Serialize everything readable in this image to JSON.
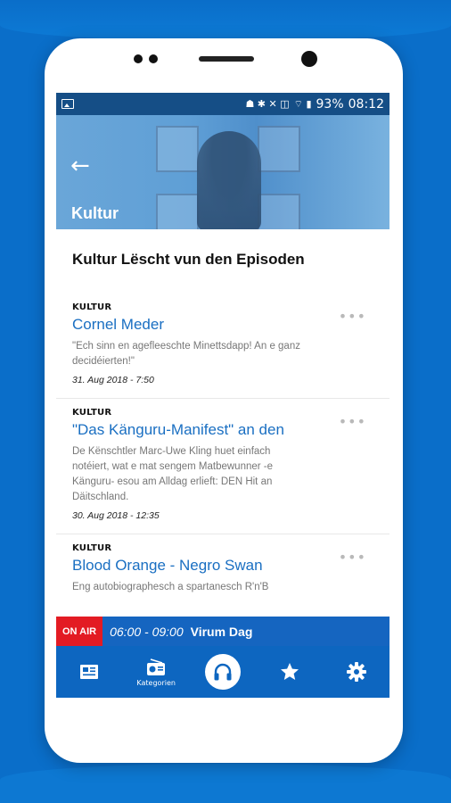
{
  "status_bar": {
    "battery": "93%",
    "time": "08:12"
  },
  "header": {
    "back_icon": "back-arrow-icon",
    "title": "Kultur"
  },
  "section": {
    "title": "Kultur Lëscht vun den Episoden"
  },
  "episodes": [
    {
      "category": "KULTUR",
      "title": "Cornel Meder",
      "description": "\"Ech sinn en agefleeschte Minettsdapp! An e ganz decidéierten!\"",
      "date": "31. Aug 2018 - 7:50"
    },
    {
      "category": "KULTUR",
      "title": "\"Das Känguru-Manifest\" an den",
      "description": "De Kënschtler Marc-Uwe Kling huet einfach notéiert, wat e mat sengem Matbewunner -e Känguru- esou am Alldag erlieft: DEN Hit an Däitschland.",
      "date": "30. Aug 2018 - 12:35"
    },
    {
      "category": "KULTUR",
      "title": "Blood Orange - Negro Swan",
      "description": "Eng autobiographesch a spartanesch R'n'B",
      "date": ""
    }
  ],
  "on_air": {
    "badge": "ON AIR",
    "time": "06:00 - 09:00",
    "show": "Virum Dag"
  },
  "tabs": [
    {
      "icon": "news-icon",
      "label": ""
    },
    {
      "icon": "radio-icon",
      "label": "Kategorien"
    },
    {
      "icon": "headphones-icon",
      "label": ""
    },
    {
      "icon": "star-icon",
      "label": ""
    },
    {
      "icon": "gear-icon",
      "label": ""
    }
  ],
  "colors": {
    "background": "#0a6ec9",
    "status_bar": "#154e86",
    "accent_blue": "#1a6fc2",
    "tab_bar": "#0d66c0",
    "on_air_red": "#e31b23"
  }
}
